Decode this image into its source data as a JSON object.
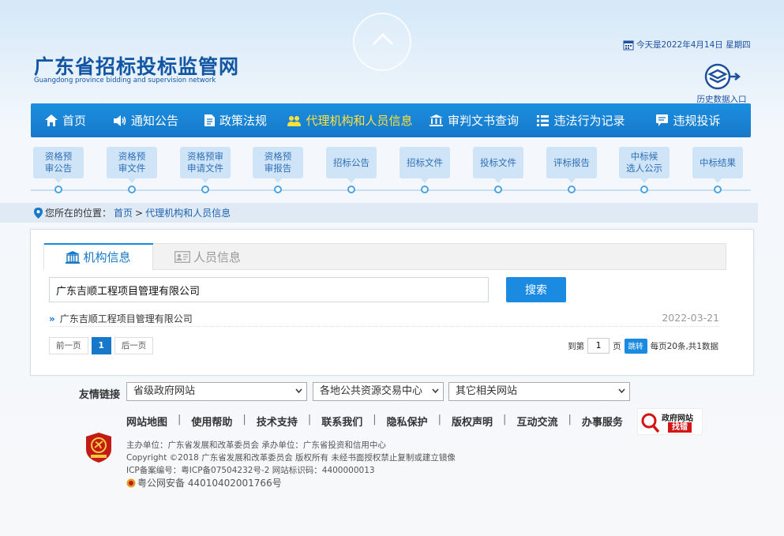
{
  "header": {
    "site_title": "广东省招标投标监管网",
    "site_title_en": "Guangdong province bidding and supervision network",
    "date_text": "今天是2022年4月14日  星期四",
    "history_label": "历史数据入口"
  },
  "main_nav": [
    {
      "label": "首页",
      "icon": "home-icon"
    },
    {
      "label": "通知公告",
      "icon": "speaker-icon"
    },
    {
      "label": "政策法规",
      "icon": "document-icon"
    },
    {
      "label": "代理机构和人员信息",
      "icon": "people-icon",
      "active": true
    },
    {
      "label": "审判文书查询",
      "icon": "court-icon"
    },
    {
      "label": "违法行为记录",
      "icon": "list-icon"
    },
    {
      "label": "违规投诉",
      "icon": "message-icon"
    }
  ],
  "sub_nav": [
    {
      "line1": "资格预",
      "line2": "审公告"
    },
    {
      "line1": "资格预",
      "line2": "审文件"
    },
    {
      "line1": "资格预审",
      "line2": "申请文件"
    },
    {
      "line1": "资格预",
      "line2": "审报告"
    },
    {
      "line1": "招标公告",
      "line2": ""
    },
    {
      "line1": "招标文件",
      "line2": ""
    },
    {
      "line1": "投标文件",
      "line2": ""
    },
    {
      "line1": "评标报告",
      "line2": ""
    },
    {
      "line1": "中标候",
      "line2": "选人公示"
    },
    {
      "line1": "中标结果",
      "line2": ""
    }
  ],
  "breadcrumb": {
    "prefix": "您所在的位置：",
    "home": "首页",
    "sep": ">",
    "current": "代理机构和人员信息"
  },
  "tabs": [
    {
      "label": "机构信息",
      "icon": "building-icon",
      "active": true
    },
    {
      "label": "人员信息",
      "icon": "id-card-icon",
      "active": false
    }
  ],
  "search": {
    "value": "广东吉顺工程项目管理有限公司",
    "button": "搜索"
  },
  "results": [
    {
      "title": "广东吉顺工程项目管理有限公司",
      "date": "2022-03-21"
    }
  ],
  "pager": {
    "prev": "前一页",
    "current": "1",
    "next": "后一页",
    "goto_prefix": "到第",
    "page_value": "1",
    "page_suffix": "页",
    "jump": "跳转",
    "summary": "每页20条,共1数据"
  },
  "footer": {
    "links_label": "友情链接",
    "selects": [
      "省级政府网站",
      "各地公共资源交易中心",
      "其它相关网站"
    ],
    "links": [
      "网站地图",
      "使用帮助",
      "技术支持",
      "联系我们",
      "隐私保护",
      "版权声明",
      "互动交流",
      "办事服务"
    ],
    "link_sep": "|",
    "gov_badge_line1": "政府网站",
    "gov_badge_line2": "找错",
    "info_line1": "主办单位：广东省发展和改革委员会     承办单位：广东省投资和信用中心",
    "info_line2": "Copyright ©2018    广东省发展和改革委员会     版权所有 未经书面授权禁止复制或建立镜像",
    "info_line3": "ICP备案编号：粤ICP备07504232号-2          网站标识码：4400000013",
    "info_line4": "粤公网安备 44010402001766号"
  },
  "colors": {
    "nav_blue": "#1778c9",
    "nav_active": "#ffe13a",
    "title_blue": "#1155a3",
    "step_bg": "#cfe4f7",
    "badge_red": "#d21515"
  }
}
